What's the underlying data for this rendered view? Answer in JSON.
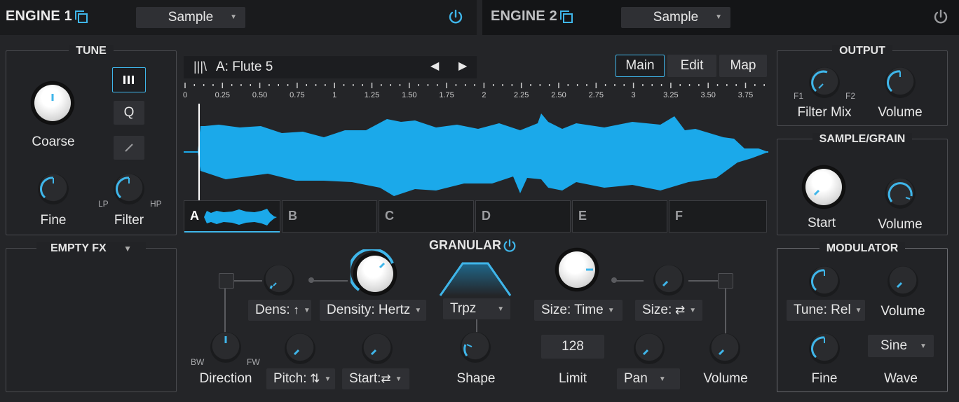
{
  "engine1": {
    "title": "ENGINE 1",
    "select": "Sample"
  },
  "engine2": {
    "title": "ENGINE 2",
    "select": "Sample"
  },
  "tune": {
    "title": "TUNE",
    "coarse_label": "Coarse",
    "fine_label": "Fine",
    "filter_label": "Filter",
    "lp": "LP",
    "hp": "HP",
    "q_label": "Q"
  },
  "empty_fx": {
    "title": "EMPTY FX"
  },
  "sample": {
    "name_icon": "|||\\",
    "name": "A:  Flute 5",
    "tabs": [
      "Main",
      "Edit",
      "Map"
    ],
    "active_tab": "Main",
    "ruler": [
      "0",
      "0.25",
      "0.50",
      "0.75",
      "1",
      "1.25",
      "1.50",
      "1.75",
      "2",
      "2.25",
      "2.50",
      "2.75",
      "3",
      "3.25",
      "3.50",
      "3.75"
    ],
    "slots": [
      "A",
      "B",
      "C",
      "D",
      "E",
      "F"
    ],
    "active_slot": "A"
  },
  "granular": {
    "title": "GRANULAR",
    "dens": "Dens:",
    "density": "Density: Hertz",
    "direction": "Direction",
    "bw": "BW",
    "fw": "FW",
    "pitch": "Pitch:",
    "start": "Start:",
    "shape_select": "Trpz",
    "shape": "Shape",
    "size_time": "Size: Time",
    "size2": "Size:",
    "limit_value": "128",
    "limit": "Limit",
    "pan": "Pan",
    "volume": "Volume"
  },
  "output": {
    "title": "OUTPUT",
    "f1": "F1",
    "f2": "F2",
    "filter_mix": "Filter Mix",
    "volume": "Volume"
  },
  "sample_grain": {
    "title": "SAMPLE/GRAIN",
    "start": "Start",
    "volume": "Volume"
  },
  "modulator": {
    "title": "MODULATOR",
    "tune_rel": "Tune: Rel",
    "volume": "Volume",
    "fine": "Fine",
    "wave_select": "Sine",
    "wave": "Wave"
  },
  "colors": {
    "accent": "#3fb6ea",
    "waveform": "#1ba9ea",
    "bg": "#242528"
  }
}
